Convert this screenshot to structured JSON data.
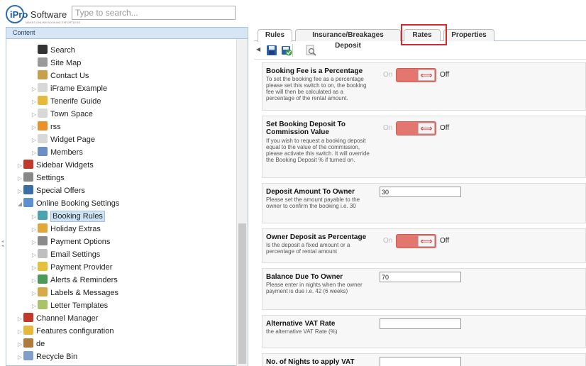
{
  "app": {
    "logo_brand": "iPro",
    "logo_suffix": " Software",
    "logo_tagline": "MAKES ONLINE BOOKING EFFORTLESS",
    "search_placeholder": "Type to search..."
  },
  "left_panel": {
    "header": "Content",
    "tree": [
      {
        "label": "Search",
        "icon": "binoculars-icon",
        "color": "#333333",
        "expandable": false,
        "indent": 2
      },
      {
        "label": "Site Map",
        "icon": "sitemap-icon",
        "color": "#9a9a9a",
        "expandable": false,
        "indent": 2
      },
      {
        "label": "Contact Us",
        "icon": "contact-icon",
        "color": "#c9a04a",
        "expandable": false,
        "indent": 2
      },
      {
        "label": "iFrame Example",
        "icon": "page-icon",
        "color": "#d8d8d8",
        "expandable": true,
        "indent": 2
      },
      {
        "label": "Tenerife Guide",
        "icon": "folder-icon",
        "color": "#e6b93c",
        "expandable": true,
        "indent": 2
      },
      {
        "label": "Town Space",
        "icon": "page-icon",
        "color": "#d8d8d8",
        "expandable": true,
        "indent": 2
      },
      {
        "label": "rss",
        "icon": "rss-icon",
        "color": "#e8912d",
        "expandable": true,
        "indent": 2
      },
      {
        "label": "Widget Page",
        "icon": "page-icon",
        "color": "#d8d8d8",
        "expandable": true,
        "indent": 2
      },
      {
        "label": "Members",
        "icon": "members-icon",
        "color": "#6b8fc4",
        "expandable": true,
        "indent": 2
      },
      {
        "label": "Sidebar Widgets",
        "icon": "widgets-icon",
        "color": "#c0392b",
        "expandable": true,
        "indent": 1
      },
      {
        "label": "Settings",
        "icon": "gear-icon",
        "color": "#888888",
        "expandable": true,
        "indent": 1
      },
      {
        "label": "Special Offers",
        "icon": "python-icon",
        "color": "#3a6ea5",
        "expandable": true,
        "indent": 1
      },
      {
        "label": "Online Booking Settings",
        "icon": "booking-settings-icon",
        "color": "#5b8fd0",
        "expandable": true,
        "expanded": true,
        "indent": 1
      },
      {
        "label": "Booking Rules",
        "icon": "booking-rules-icon",
        "color": "#4aa3b0",
        "expandable": true,
        "indent": 2,
        "selected": true
      },
      {
        "label": "Holiday Extras",
        "icon": "holiday-extras-icon",
        "color": "#e2a73a",
        "expandable": true,
        "indent": 2
      },
      {
        "label": "Payment Options",
        "icon": "payment-options-icon",
        "color": "#8a8a8a",
        "expandable": true,
        "indent": 2
      },
      {
        "label": "Email Settings",
        "icon": "email-icon",
        "color": "#bfbfbf",
        "expandable": true,
        "indent": 2
      },
      {
        "label": "Payment Provider",
        "icon": "coins-icon",
        "color": "#e6c03c",
        "expandable": true,
        "indent": 2
      },
      {
        "label": "Alerts & Reminders",
        "icon": "alerts-icon",
        "color": "#4c9a5a",
        "expandable": true,
        "indent": 2
      },
      {
        "label": "Labels & Messages",
        "icon": "labels-icon",
        "color": "#d6a94a",
        "expandable": true,
        "indent": 2
      },
      {
        "label": "Letter Templates",
        "icon": "letter-icon",
        "color": "#a8c36a",
        "expandable": true,
        "indent": 2
      },
      {
        "label": "Channel Manager",
        "icon": "channel-icon",
        "color": "#c0392b",
        "expandable": true,
        "indent": 1
      },
      {
        "label": "Features configuration",
        "icon": "folder-icon",
        "color": "#e6b93c",
        "expandable": true,
        "indent": 1
      },
      {
        "label": "de",
        "icon": "home-icon",
        "color": "#b07a3a",
        "expandable": true,
        "indent": 1
      },
      {
        "label": "Recycle Bin",
        "icon": "recycle-bin-icon",
        "color": "#7f9fc8",
        "expandable": true,
        "indent": 1
      }
    ]
  },
  "right_panel": {
    "tabs": [
      {
        "label": "Rules",
        "active": true
      },
      {
        "label": "Insurance/Breakages Deposit",
        "active": false
      },
      {
        "label": "Rates",
        "active": false,
        "highlighted": true
      },
      {
        "label": "Properties",
        "active": false
      }
    ],
    "toolbar": {
      "save_icon": "save-icon",
      "save_publish_icon": "save-publish-icon",
      "preview_icon": "preview-icon"
    },
    "fields": [
      {
        "title": "Booking Fee is a Percentage",
        "desc": "To set the booking fee as a percentage please set this switch to on, the booking fee will then be calculated as a percentage of the rental amount.",
        "type": "toggle",
        "on": "On",
        "off": "Off"
      },
      {
        "title": "Set Booking Deposit To Commission Value",
        "desc": "If you wish to request a booking deposit equal to the value of the commission, please activate this switch. It will override the Booking Deposit % if turned on.",
        "type": "toggle",
        "on": "On",
        "off": "Off"
      },
      {
        "title": "Deposit Amount To Owner",
        "desc": "Please set the amount payable to the owner to confirm the booking i.e. 30",
        "type": "input",
        "value": "30"
      },
      {
        "title": "Owner Deposit as Percentage",
        "desc": "Is the deposit a fixed amount or a percentage of rental amount",
        "type": "toggle",
        "on": "On",
        "off": "Off"
      },
      {
        "title": "Balance Due To Owner",
        "desc": "Please enter in nights when the owner payment is due i.e. 42 (6 weeks)",
        "type": "input",
        "value": "70"
      },
      {
        "title": "Alternative VAT Rate",
        "desc": "the alternative VAT Rate (%)",
        "type": "input",
        "value": ""
      },
      {
        "title": "No. of Nights to apply VAT",
        "desc": "",
        "type": "input",
        "value": ""
      }
    ]
  }
}
